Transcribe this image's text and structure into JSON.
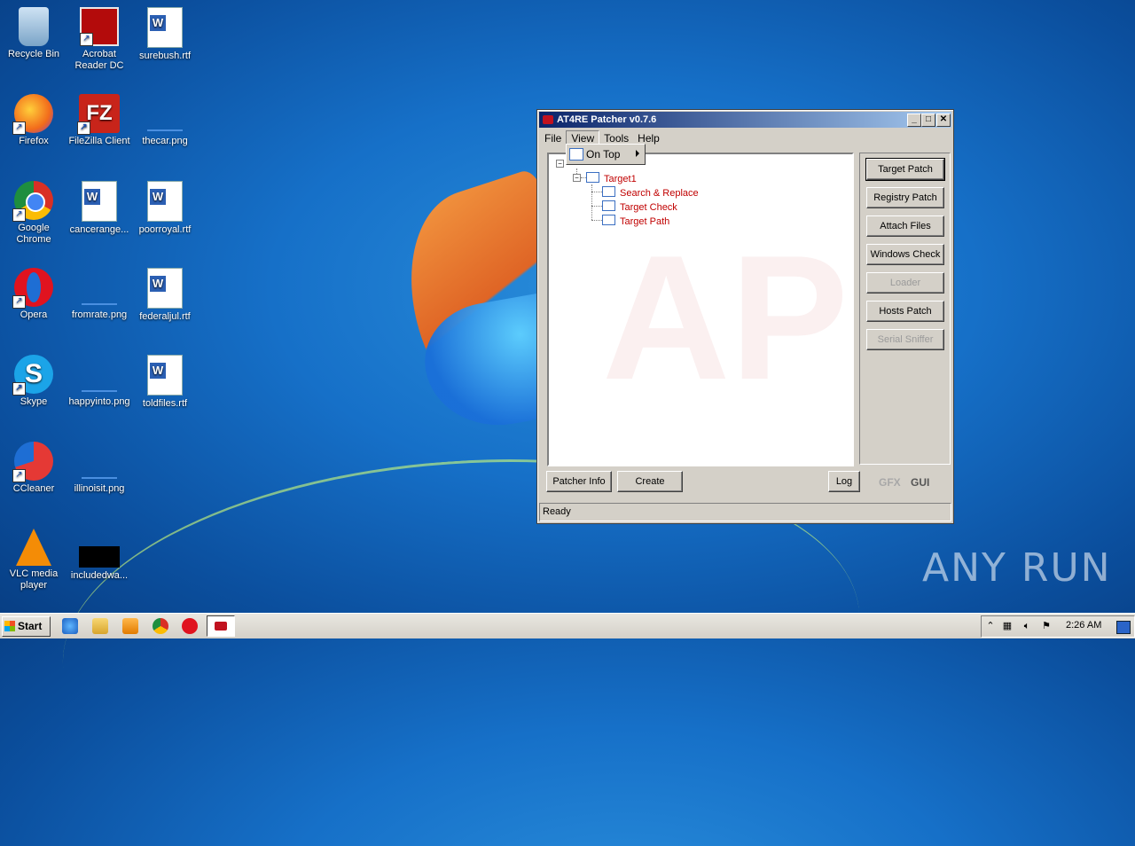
{
  "desktop": {
    "icons": [
      {
        "label": "Recycle Bin"
      },
      {
        "label": "Acrobat Reader DC"
      },
      {
        "label": "surebush.rtf"
      },
      {
        "label": "Firefox"
      },
      {
        "label": "FileZilla Client"
      },
      {
        "label": "thecar.png"
      },
      {
        "label": "Google Chrome"
      },
      {
        "label": "cancerange..."
      },
      {
        "label": "poorroyal.rtf"
      },
      {
        "label": "Opera"
      },
      {
        "label": "fromrate.png"
      },
      {
        "label": "federaljul.rtf"
      },
      {
        "label": "Skype"
      },
      {
        "label": "happyinto.png"
      },
      {
        "label": "toldfiles.rtf"
      },
      {
        "label": "CCleaner"
      },
      {
        "label": "illinoisit.png"
      },
      {
        "label": "VLC media player"
      },
      {
        "label": "includedwa..."
      }
    ],
    "watermark": "ANY RUN"
  },
  "window": {
    "title": "AT4RE Patcher v0.7.6",
    "menu": [
      "File",
      "View",
      "Tools",
      "Help"
    ],
    "dropdown_item": "On Top",
    "tree": {
      "root": "Target1",
      "children": [
        "Search & Replace",
        "Target Check",
        "Target Path"
      ]
    },
    "side_buttons": [
      {
        "label": "Target Patch",
        "enabled": true
      },
      {
        "label": "Registry Patch",
        "enabled": true
      },
      {
        "label": "Attach Files",
        "enabled": true
      },
      {
        "label": "Windows Check",
        "enabled": true
      },
      {
        "label": "Loader",
        "enabled": false
      },
      {
        "label": "Hosts Patch",
        "enabled": true
      },
      {
        "label": "Serial Sniffer",
        "enabled": false
      }
    ],
    "bottom": {
      "patcher_info": "Patcher Info",
      "create": "Create",
      "log": "Log",
      "gfx": "GFX",
      "gui": "GUI"
    },
    "status": "Ready"
  },
  "taskbar": {
    "start": "Start",
    "clock": "2:26 AM"
  },
  "colors": {
    "tree_text": "#c00000",
    "title_gradient_start": "#0a246a"
  }
}
